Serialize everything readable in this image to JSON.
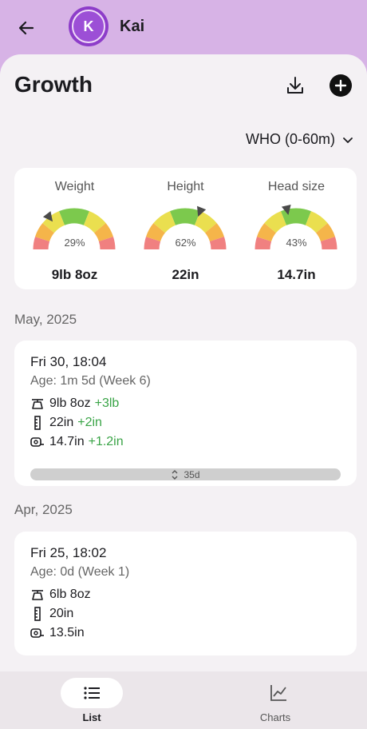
{
  "header": {
    "child_name": "Kai",
    "avatar_initial": "K"
  },
  "page": {
    "title": "Growth"
  },
  "standard": {
    "selected": "WHO (0-60m)"
  },
  "gauges": [
    {
      "label": "Weight",
      "percentile": "29%",
      "value": "9lb 8oz",
      "fraction": 0.29
    },
    {
      "label": "Height",
      "percentile": "62%",
      "value": "22in",
      "fraction": 0.62
    },
    {
      "label": "Head size",
      "percentile": "43%",
      "value": "14.7in",
      "fraction": 0.43
    }
  ],
  "groups": [
    {
      "month": "May, 2025",
      "entries": [
        {
          "date": "Fri 30, 18:04",
          "age": "Age: 1m 5d (Week 6)",
          "weight": "9lb 8oz",
          "weight_delta": "+3lb",
          "height": "22in",
          "height_delta": "+2in",
          "head": "14.7in",
          "head_delta": "+1.2in",
          "gap": "35d"
        }
      ]
    },
    {
      "month": "Apr, 2025",
      "entries": [
        {
          "date": "Fri 25, 18:02",
          "age": "Age: 0d (Week 1)",
          "weight": "6lb 8oz",
          "height": "20in",
          "head": "13.5in"
        }
      ]
    }
  ],
  "nav": {
    "list_label": "List",
    "charts_label": "Charts"
  },
  "colors": {
    "header_bg": "#d7b3e6",
    "avatar": "#9c4fd6",
    "delta_green": "#3aa447"
  }
}
